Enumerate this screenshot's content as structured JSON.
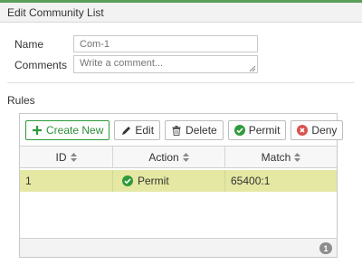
{
  "dialog": {
    "title": "Edit Community List"
  },
  "form": {
    "name_label": "Name",
    "name_value": "Com-1",
    "comments_label": "Comments",
    "comments_placeholder": "Write a comment..."
  },
  "rules": {
    "section_label": "Rules",
    "toolbar": {
      "create_new": "Create New",
      "edit": "Edit",
      "delete": "Delete",
      "permit": "Permit",
      "deny": "Deny"
    },
    "columns": [
      "ID",
      "Action",
      "Match"
    ],
    "rows": [
      {
        "id": "1",
        "action": "Permit",
        "match": "65400:1"
      }
    ],
    "count": "1"
  },
  "colors": {
    "accent": "#2f9a3c",
    "selected_row": "#e4e8a3",
    "deny": "#d9534f"
  },
  "icons": {
    "create": "plus-icon",
    "edit": "pencil-icon",
    "delete": "trash-icon",
    "permit": "check-circle-icon",
    "deny": "x-circle-icon",
    "sort": "sort-icon"
  }
}
